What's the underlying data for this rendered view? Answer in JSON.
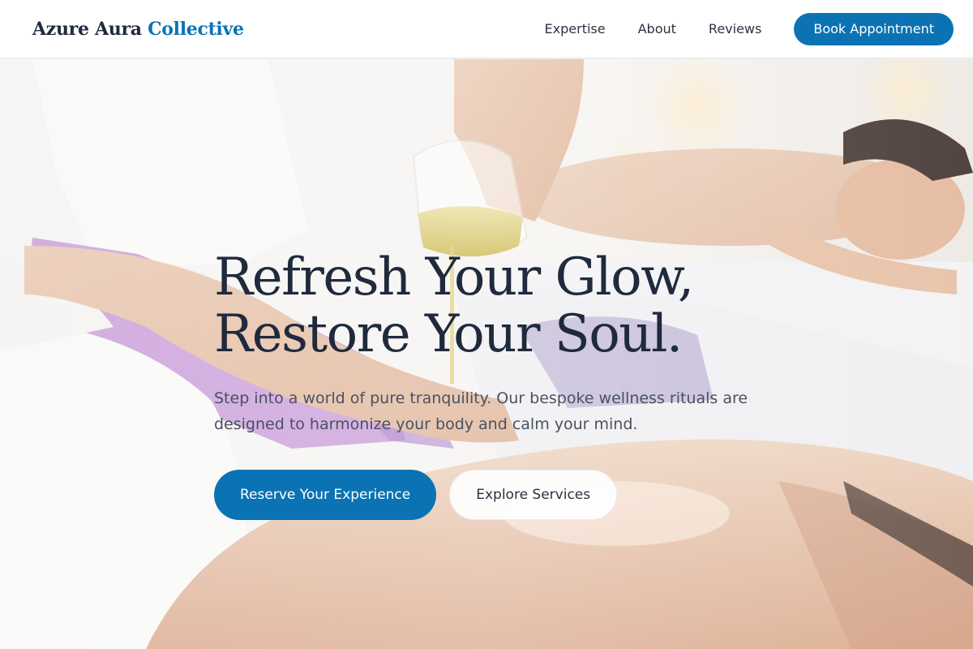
{
  "header": {
    "logo": {
      "primary": "Azure Aura",
      "accent": "Collective"
    },
    "nav": [
      {
        "label": "Expertise"
      },
      {
        "label": "About"
      },
      {
        "label": "Reviews"
      }
    ],
    "cta_label": "Book Appointment"
  },
  "hero": {
    "headline": [
      "Refresh Your Glow,",
      "Restore Your Soul."
    ],
    "subtext": "Step into a world of pure tranquility. Our bespoke wellness rituals are designed to harmonize your body and calm your mind.",
    "primary_cta": "Reserve Your Experience",
    "secondary_cta": "Explore Services"
  },
  "colors": {
    "accent": "#0b73b3",
    "heading": "#1f2a3c",
    "body_text": "#4a5160",
    "header_bg": "#ffffff"
  }
}
